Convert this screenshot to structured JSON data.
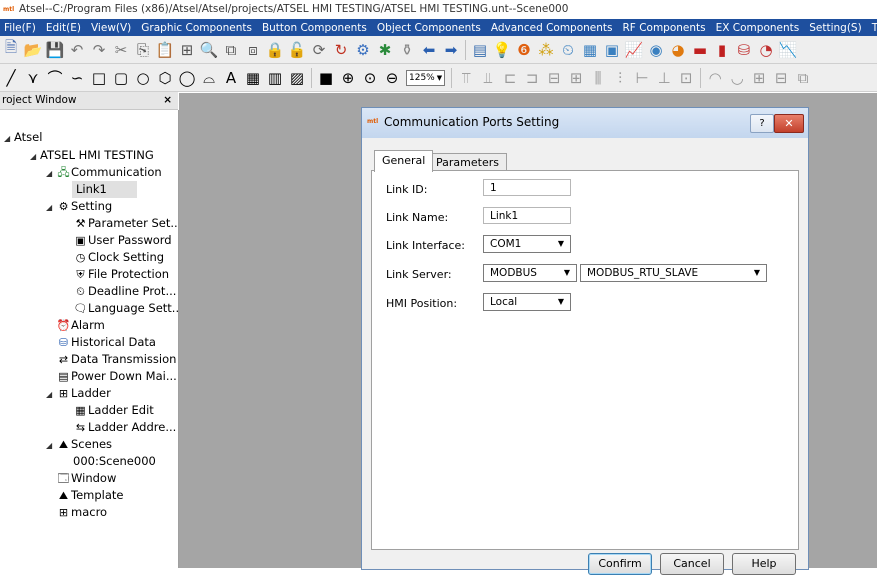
{
  "app": {
    "title": "Atsel--C:/Program Files (x86)/Atsel/Atsel/projects/ATSEL HMI TESTING/ATSEL HMI TESTING.unt--Scene000",
    "icon_text": "mtl"
  },
  "menu": [
    "File(F)",
    "Edit(E)",
    "View(V)",
    "Graphic Components",
    "Button Components",
    "Object Components",
    "Advanced Components",
    "RF Components",
    "EX Components",
    "Setting(S)",
    "Tool(T)"
  ],
  "toolbar": {
    "zoom": "125%"
  },
  "project_window": {
    "title": "roject Window",
    "close": "×",
    "tree": {
      "root": "Atsel",
      "project": "ATSEL HMI TESTING",
      "communication": "Communication",
      "link1": "Link1",
      "setting": "Setting",
      "parameter_set": "Parameter Set...",
      "user_password": "User Password",
      "clock_setting": "Clock Setting",
      "file_protection": "File Protection",
      "deadline_prot": "Deadline Prot...",
      "language_sett": "Language Sett...",
      "alarm": "Alarm",
      "historical_data": "Historical Data",
      "data_transmission": "Data Transmission",
      "power_down": "Power Down Mai...",
      "ladder": "Ladder",
      "ladder_edit": "Ladder Edit",
      "ladder_addre": "Ladder Addre...",
      "scenes": "Scenes",
      "scene000": "000:Scene000",
      "window": "Window",
      "template": "Template",
      "macro": "macro"
    }
  },
  "dialog": {
    "title": "Communication Ports Setting",
    "help_q": "?",
    "close_x": "✕",
    "tabs": {
      "general": "General",
      "parameters": "Parameters"
    },
    "fields": {
      "link_id": {
        "label": "Link ID:",
        "value": "1"
      },
      "link_name": {
        "label": "Link Name:",
        "value": "Link1"
      },
      "link_interface": {
        "label": "Link Interface:",
        "value": "COM1"
      },
      "link_server": {
        "label": "Link Server:",
        "value": "MODBUS",
        "value2": "MODBUS_RTU_SLAVE"
      },
      "hmi_position": {
        "label": "HMI Position:",
        "value": "Local"
      }
    },
    "buttons": {
      "confirm": "Confirm",
      "cancel": "Cancel",
      "help": "Help"
    }
  },
  "colors": {
    "menubar": "#1e4f9e",
    "canvas": "#a5a5a5",
    "dialog_bg": "#f0f0f0",
    "close_red": "#c2402c"
  }
}
